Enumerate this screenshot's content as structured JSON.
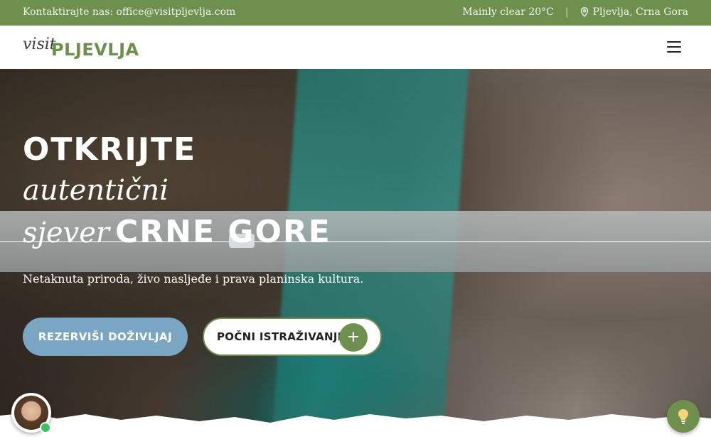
{
  "topbar": {
    "contact": "Kontaktirajte nas: office@visitpljevlja.com",
    "weather": "Mainly clear 20°C",
    "separator": "|",
    "location": "Pljevlja, Crna Gora"
  },
  "header": {
    "logo_script": "visit",
    "logo_name": "PLJEVLJA"
  },
  "hero": {
    "line1": "OTKRIJTE",
    "line2": "autentični",
    "line3_script": "sjever",
    "line3_caps": "CRNE GORE",
    "subtitle": "Netaknuta priroda, živo nasljeđe i prava planinska kultura.",
    "cta_primary": "REZERVIŠI DOŽIVLJAJ",
    "cta_secondary": "POČNI ISTRAŽIVANJE",
    "cta_secondary_icon": "+"
  },
  "icons": {
    "location": "map-pin-icon",
    "menu": "hamburger-menu-icon",
    "assistant": "lightbulb-icon"
  },
  "colors": {
    "brand_green": "#6f8f4f",
    "primary_button": "#7aa6c4",
    "online": "#3cc35c"
  }
}
